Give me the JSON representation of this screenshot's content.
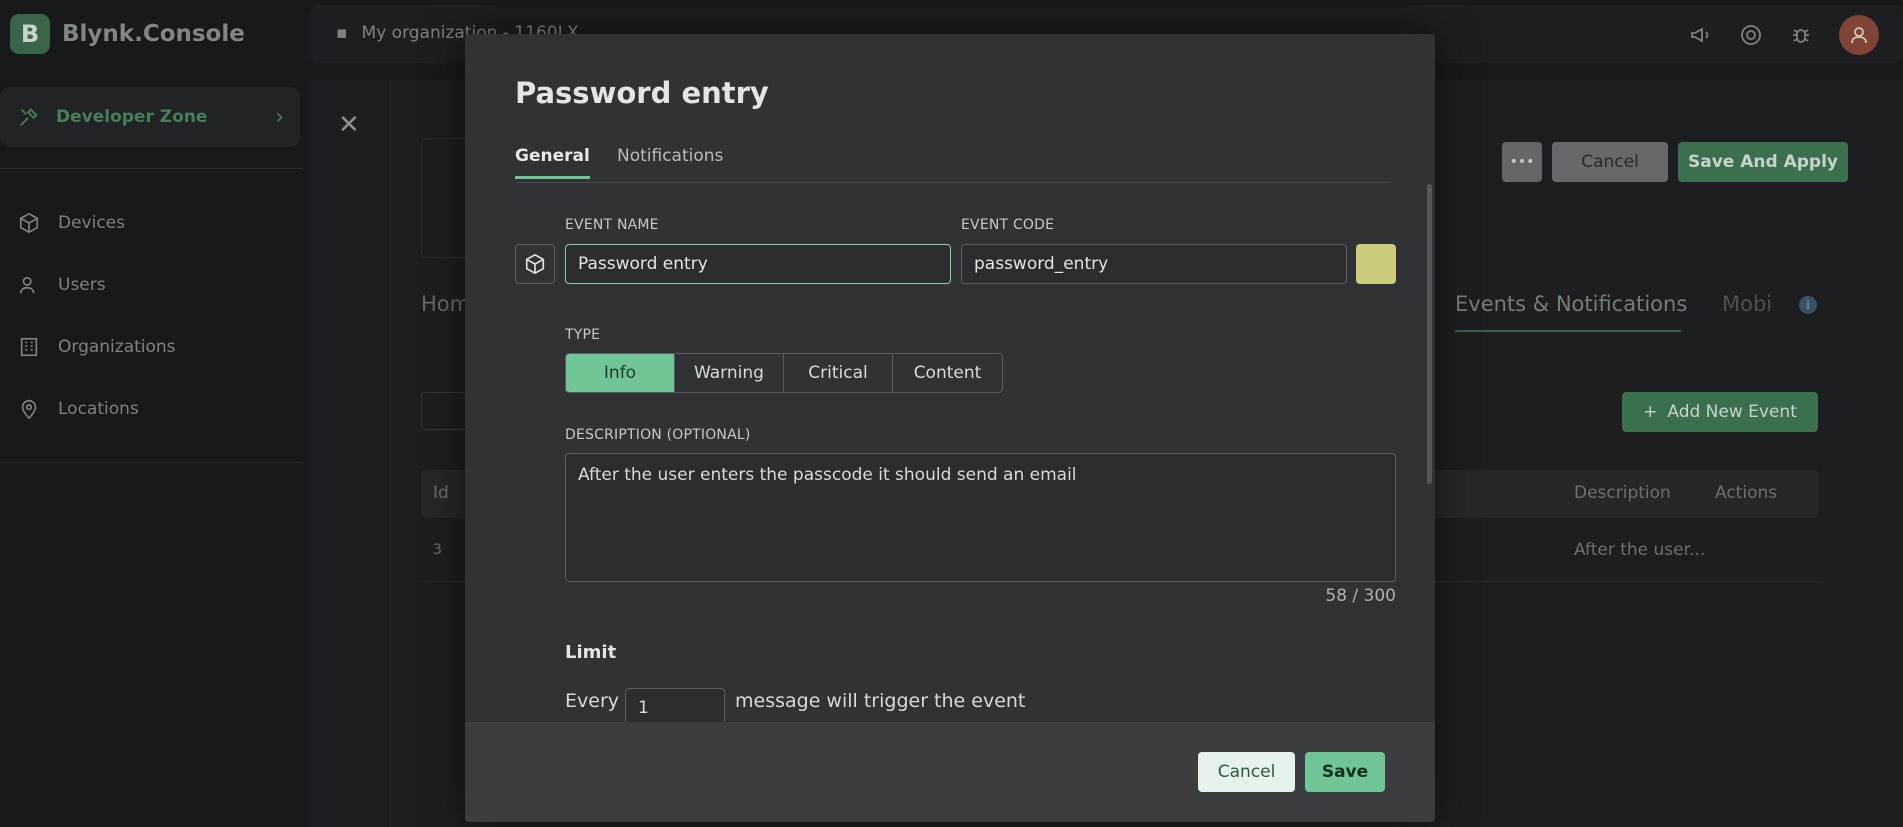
{
  "app": {
    "logo_letter": "B",
    "name": "Blynk.Console"
  },
  "sidebar": {
    "developer_zone": "Developer Zone",
    "items": [
      {
        "label": "Devices",
        "icon": "cube-icon"
      },
      {
        "label": "Users",
        "icon": "users-icon"
      },
      {
        "label": "Organizations",
        "icon": "building-icon"
      },
      {
        "label": "Locations",
        "icon": "location-pin-icon"
      }
    ]
  },
  "topbar": {
    "org_name": "My organization - 1160LX",
    "icons": [
      "megaphone-icon",
      "lifebuoy-icon",
      "bug-icon",
      "avatar"
    ]
  },
  "background": {
    "tab_home": "Hom",
    "tab_events": "Events & Notifications",
    "tab_mobile": "Mobi",
    "header_cancel": "Cancel",
    "header_save_apply": "Save And Apply",
    "add_event": "Add New Event",
    "table_headers": {
      "id": "Id",
      "description": "Description",
      "actions": "Actions"
    },
    "row": {
      "id": "3",
      "description": "After the user..."
    }
  },
  "modal": {
    "title": "Password entry",
    "tabs": [
      {
        "label": "General",
        "active": true
      },
      {
        "label": "Notifications",
        "active": false
      }
    ],
    "event_name_label": "EVENT NAME",
    "event_name_value": "Password entry",
    "event_code_label": "EVENT CODE",
    "event_code_value": "password_entry",
    "event_color": "#c9cc7a",
    "type_label": "TYPE",
    "types": [
      "Info",
      "Warning",
      "Critical",
      "Content"
    ],
    "selected_type": "Info",
    "description_label": "DESCRIPTION (OPTIONAL)",
    "description_value": "After the user enters the passcode it should send an email",
    "counter": "58 / 300",
    "limit_title": "Limit",
    "limit_prefix": "Every",
    "limit_value": "1",
    "limit_suffix": "message will trigger the event",
    "cancel_label": "Cancel",
    "save_label": "Save"
  },
  "colors": {
    "accent": "#6fc596",
    "modal_bg": "#303236"
  }
}
